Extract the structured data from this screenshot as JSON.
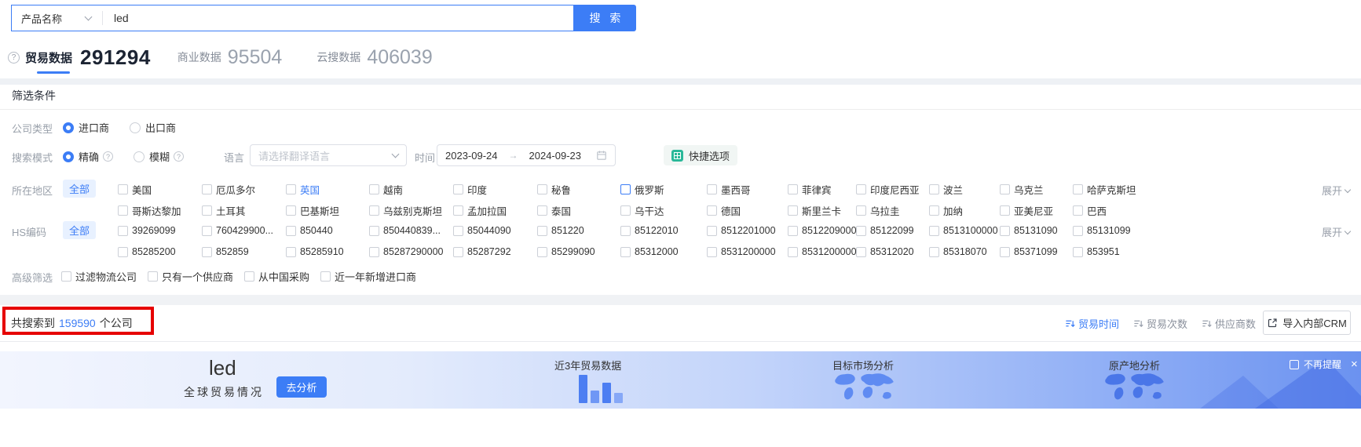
{
  "search_bar": {
    "category": "产品名称",
    "query": "led",
    "search_button": "搜 索"
  },
  "tabs": [
    {
      "label": "贸易数据",
      "count": "291294",
      "active": true
    },
    {
      "label": "商业数据",
      "count": "95504",
      "active": false
    },
    {
      "label": "云搜数据",
      "count": "406039",
      "active": false
    }
  ],
  "filter_section": {
    "title": "筛选条件",
    "company_type": {
      "label": "公司类型",
      "options": [
        {
          "label": "进口商",
          "selected": true
        },
        {
          "label": "出口商",
          "selected": false
        }
      ]
    },
    "search_mode": {
      "label": "搜索模式",
      "options": [
        {
          "label": "精确",
          "selected": true
        },
        {
          "label": "模糊",
          "selected": false
        }
      ]
    },
    "language": {
      "label": "语言",
      "placeholder": "请选择翻译语言"
    },
    "time": {
      "label": "时间",
      "start_date": "2023-09-24",
      "end_date": "2024-09-23"
    },
    "quick_option_label": "快捷选项",
    "region": {
      "label": "所在地区",
      "all": "全部",
      "expand": "展开",
      "rows": [
        [
          {
            "label": "美国"
          },
          {
            "label": "厄瓜多尔"
          },
          {
            "label": "英国",
            "label_color": "blue"
          },
          {
            "label": "越南"
          },
          {
            "label": "印度"
          },
          {
            "label": "秘鲁"
          },
          {
            "label": "俄罗斯",
            "box": "blue"
          },
          {
            "label": "墨西哥"
          },
          {
            "label": "菲律宾"
          },
          {
            "label": "印度尼西亚"
          },
          {
            "label": "波兰"
          },
          {
            "label": "乌克兰"
          },
          {
            "label": "哈萨克斯坦"
          }
        ],
        [
          {
            "label": "哥斯达黎加"
          },
          {
            "label": "土耳其"
          },
          {
            "label": "巴基斯坦"
          },
          {
            "label": "乌兹别克斯坦"
          },
          {
            "label": "孟加拉国"
          },
          {
            "label": "泰国"
          },
          {
            "label": "乌干达"
          },
          {
            "label": "德国"
          },
          {
            "label": "斯里兰卡"
          },
          {
            "label": "乌拉圭"
          },
          {
            "label": "加纳"
          },
          {
            "label": "亚美尼亚"
          },
          {
            "label": "巴西"
          }
        ]
      ]
    },
    "hs_code": {
      "label": "HS编码",
      "all": "全部",
      "expand": "展开",
      "rows": [
        [
          "39269099",
          "760429900...",
          "850440",
          "850440839...",
          "85044090",
          "851220",
          "85122010",
          "8512201000",
          "8512209000",
          "85122099",
          "8513100000",
          "85131090",
          "85131099"
        ],
        [
          "85285200",
          "852859",
          "85285910",
          "85287290000",
          "85287292",
          "85299090",
          "85312000",
          "8531200000",
          "85312000000",
          "85312020",
          "85318070",
          "85371099",
          "853951"
        ]
      ]
    },
    "advanced": {
      "label": "高级筛选",
      "options": [
        "过滤物流公司",
        "只有一个供应商",
        "从中国采购",
        "近一年新增进口商"
      ]
    }
  },
  "results_bar": {
    "summary_prefix": "共搜索到",
    "count": "159590",
    "summary_suffix": "个公司",
    "sorts": [
      {
        "label": "贸易时间",
        "active": true
      },
      {
        "label": "贸易次数",
        "active": false
      },
      {
        "label": "供应商数",
        "active": false
      }
    ],
    "crm_button": "导入内部CRM"
  },
  "banner": {
    "keyword": "led",
    "subtitle": "全球贸易情况",
    "analyze_button": "去分析",
    "sections": [
      "近3年贸易数据",
      "目标市场分析",
      "原产地分析"
    ],
    "dismiss_label": "不再提醒",
    "close": "×"
  },
  "icons": {
    "tab_help": "?",
    "info": "?",
    "date_arrow": "→"
  },
  "colors": {
    "primary": "#3C7DF6",
    "annotation_red": "#E60000",
    "banner_bar_blue": "#4C7EF2",
    "quick_icon_green": "#29B899"
  }
}
